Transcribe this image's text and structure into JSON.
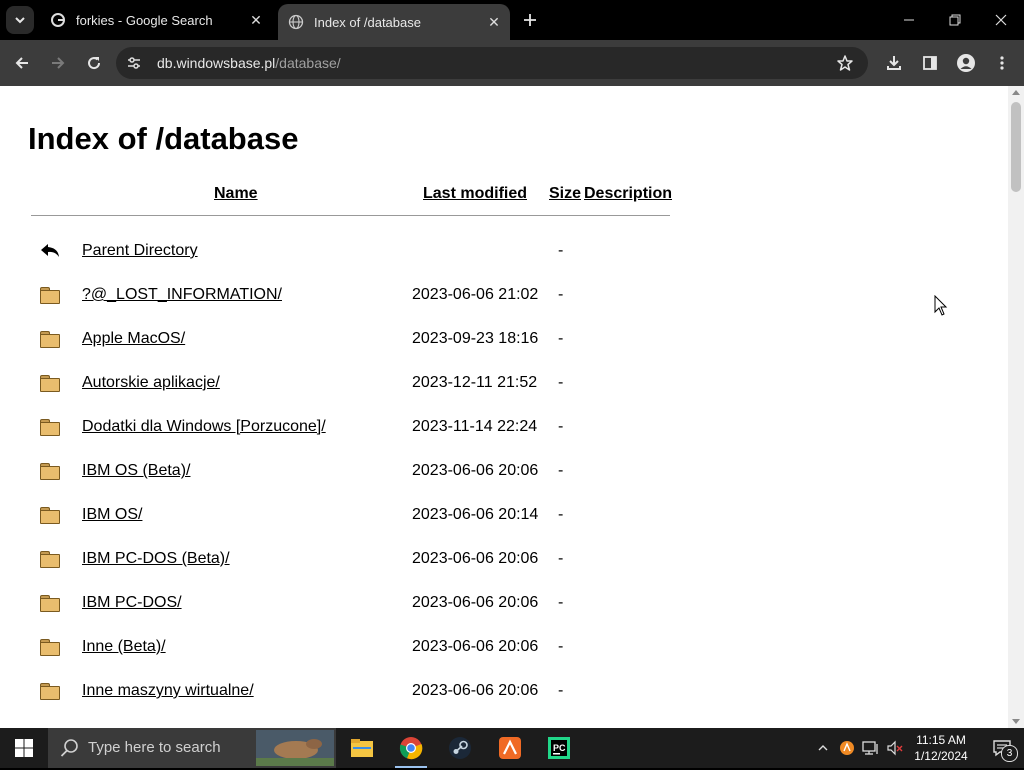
{
  "browser": {
    "tabs": [
      {
        "title": "forkies - Google Search",
        "active": false
      },
      {
        "title": "Index of /database",
        "active": true
      }
    ],
    "url_host": "db.windowsbase.pl",
    "url_path": "/database/"
  },
  "page": {
    "title": "Index of /database",
    "columns": {
      "name": "Name",
      "modified": "Last modified",
      "size": "Size",
      "description": "Description"
    },
    "entries": [
      {
        "name": "Parent Directory",
        "modified": "",
        "size": "-",
        "icon": "back-arrow-icon"
      },
      {
        "name": "?@_LOST_INFORMATION/",
        "modified": "2023-06-06 21:02",
        "size": "-",
        "icon": "folder-icon"
      },
      {
        "name": "Apple MacOS/",
        "modified": "2023-09-23 18:16",
        "size": "-",
        "icon": "folder-icon"
      },
      {
        "name": "Autorskie aplikacje/",
        "modified": "2023-12-11 21:52",
        "size": "-",
        "icon": "folder-icon"
      },
      {
        "name": "Dodatki dla Windows [Porzucone]/",
        "modified": "2023-11-14 22:24",
        "size": "-",
        "icon": "folder-icon"
      },
      {
        "name": "IBM OS (Beta)/",
        "modified": "2023-06-06 20:06",
        "size": "-",
        "icon": "folder-icon"
      },
      {
        "name": "IBM OS/",
        "modified": "2023-06-06 20:14",
        "size": "-",
        "icon": "folder-icon"
      },
      {
        "name": "IBM PC-DOS (Beta)/",
        "modified": "2023-06-06 20:06",
        "size": "-",
        "icon": "folder-icon"
      },
      {
        "name": "IBM PC-DOS/",
        "modified": "2023-06-06 20:06",
        "size": "-",
        "icon": "folder-icon"
      },
      {
        "name": "Inne (Beta)/",
        "modified": "2023-06-06 20:06",
        "size": "-",
        "icon": "folder-icon"
      },
      {
        "name": "Inne maszyny wirtualne/",
        "modified": "2023-06-06 20:06",
        "size": "-",
        "icon": "folder-icon"
      }
    ]
  },
  "taskbar": {
    "search_placeholder": "Type here to search",
    "time": "11:15 AM",
    "date": "1/12/2024",
    "notification_count": "3"
  },
  "colors": {
    "browser_frame": "#000000",
    "toolbar": "#3c3c3c",
    "omnibox": "#282828",
    "folder": "#e9bd6e",
    "taskbar": "#1c1c1c"
  }
}
